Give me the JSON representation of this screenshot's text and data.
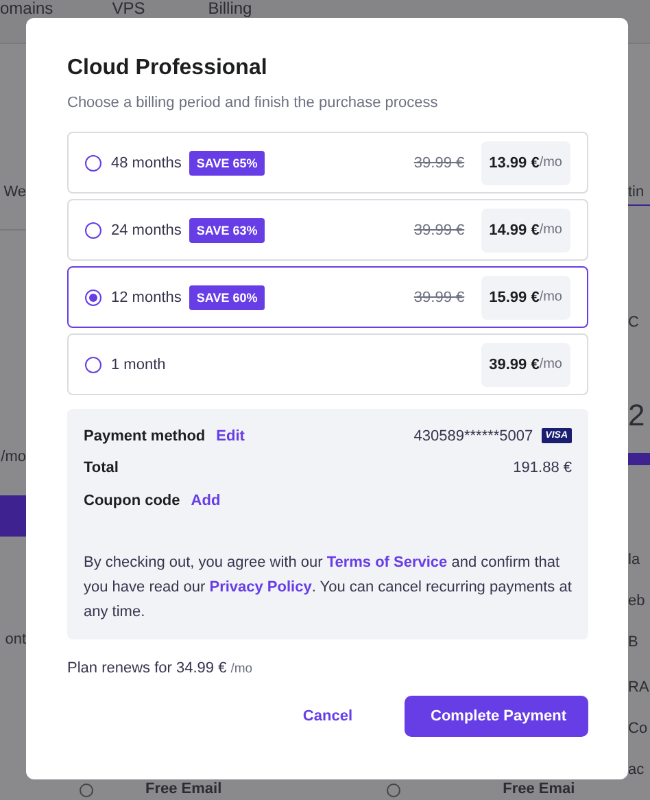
{
  "background": {
    "nav": [
      "omains",
      "VPS",
      "Billing"
    ],
    "left_fragments": [
      "We",
      "/mo",
      "ont"
    ],
    "right_fragments": [
      "tin",
      "C",
      "2",
      "la",
      "eb",
      "B",
      "RA",
      "Co",
      "ac"
    ],
    "bottom_fragments": [
      "Free Email",
      "Free Emai"
    ]
  },
  "dialog": {
    "title": "Cloud Professional",
    "subtitle": "Choose a billing period and finish the purchase process",
    "plans": [
      {
        "period": "48 months",
        "badge": "SAVE 65%",
        "old_price": "39.99 €",
        "price": "13.99 €",
        "unit": "/mo",
        "selected": false
      },
      {
        "period": "24 months",
        "badge": "SAVE 63%",
        "old_price": "39.99 €",
        "price": "14.99 €",
        "unit": "/mo",
        "selected": false
      },
      {
        "period": "12 months",
        "badge": "SAVE 60%",
        "old_price": "39.99 €",
        "price": "15.99 €",
        "unit": "/mo",
        "selected": true
      },
      {
        "period": "1 month",
        "price": "39.99 €",
        "unit": "/mo",
        "selected": false
      }
    ],
    "summary": {
      "rows": [
        {
          "label": "Payment method",
          "action": "Edit",
          "value": "430589******5007",
          "card_brand": "VISA"
        },
        {
          "label": "Total",
          "value": "191.88 €"
        },
        {
          "label": "Coupon code",
          "action": "Add"
        }
      ],
      "notice": [
        {
          "kind": "text",
          "text": "By checking out, you agree with our "
        },
        {
          "kind": "link",
          "text": "Terms of Service"
        },
        {
          "kind": "text",
          "text": " and confirm that you have read our "
        },
        {
          "kind": "link",
          "text": "Privacy Policy"
        },
        {
          "kind": "text",
          "text": ". You can cancel recurring payments at any time."
        }
      ]
    },
    "renewal": {
      "text": "Plan renews for 34.99 €",
      "unit": "/mo"
    },
    "buttons": [
      {
        "label": "Cancel",
        "kind": "secondary"
      },
      {
        "label": "Complete Payment",
        "kind": "primary"
      }
    ]
  }
}
